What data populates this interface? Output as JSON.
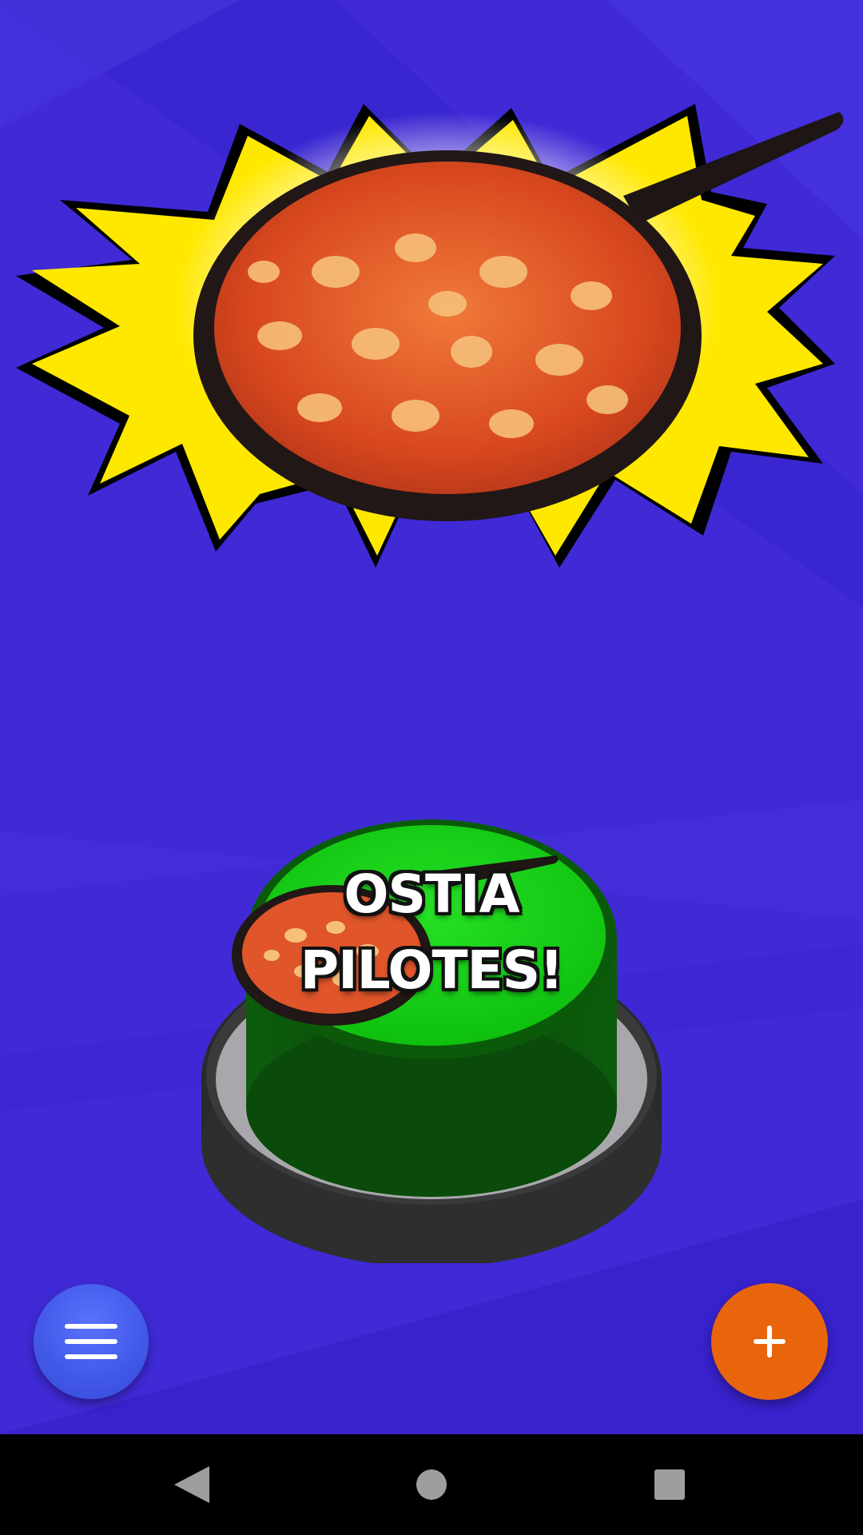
{
  "colors": {
    "background": "#3f2ad6",
    "button_green": "#10c410",
    "fab_orange": "#e8650c",
    "menu_blue": "#4158e6",
    "nav_bar": "#000000"
  },
  "hero": {
    "image": "frying-pan-with-stew",
    "burst": "yellow-explosion-burst"
  },
  "big_button": {
    "line1": "OSTIA",
    "line2": "PILOTES!"
  },
  "menu_button": {
    "icon": "hamburger-icon"
  },
  "add_button": {
    "icon": "plus-icon"
  },
  "nav_bar": {
    "back_icon": "triangle-back-icon",
    "home_icon": "circle-home-icon",
    "recents_icon": "square-recents-icon"
  }
}
